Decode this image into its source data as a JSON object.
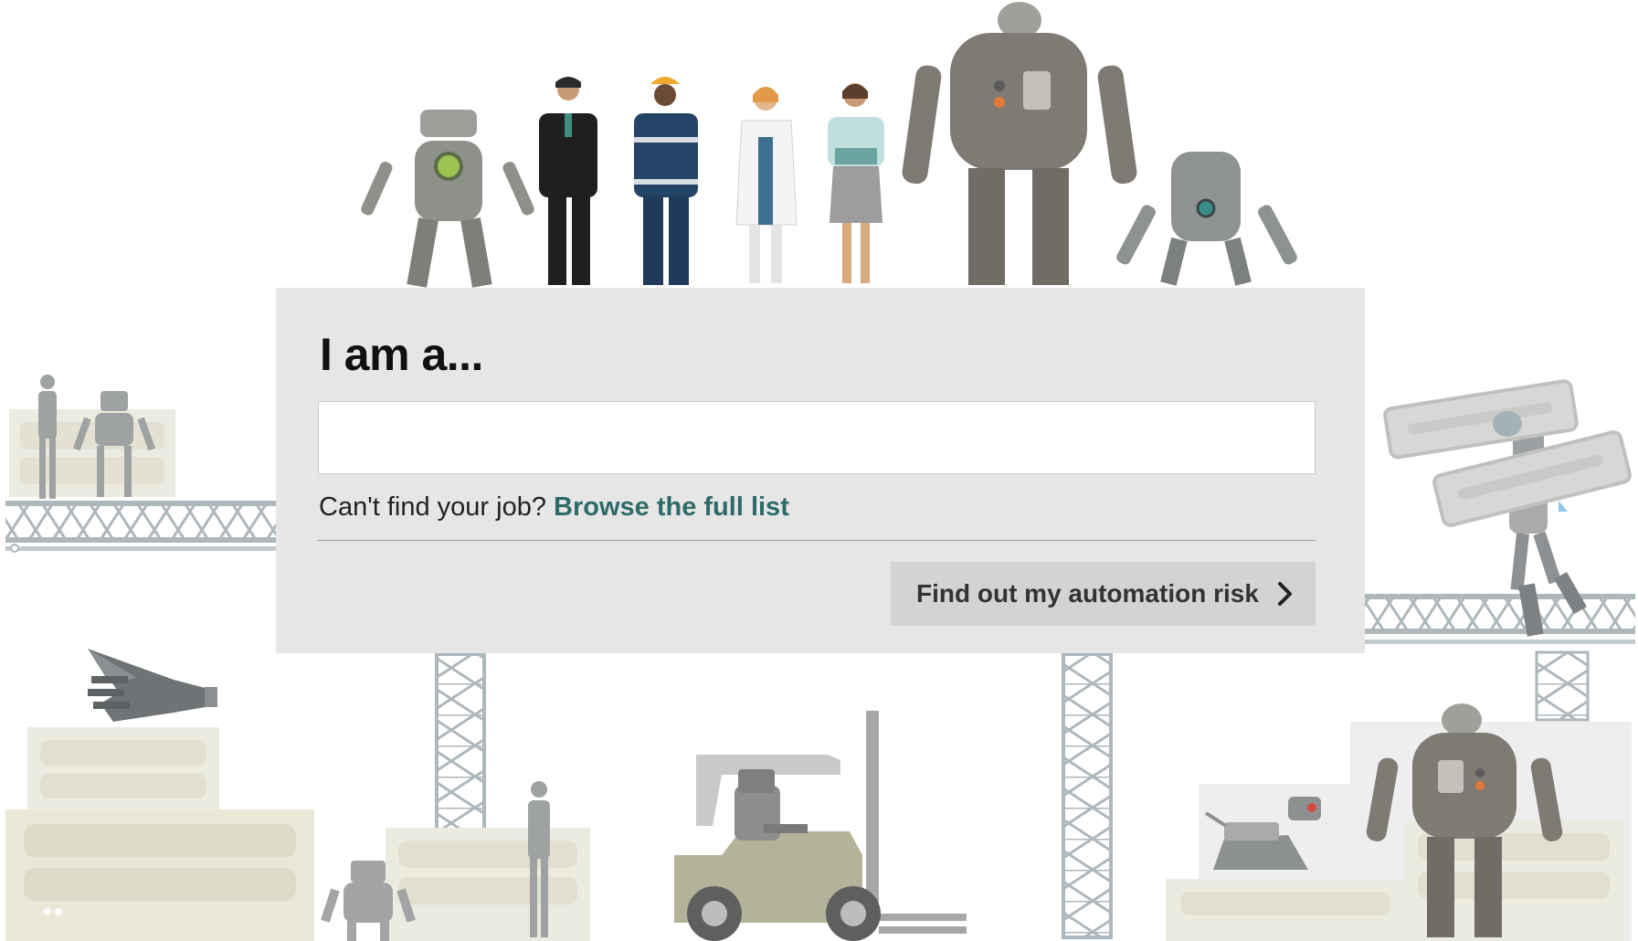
{
  "form": {
    "heading": "I am a...",
    "job_input": {
      "value": "",
      "placeholder": ""
    },
    "help_text": "Can't find your job?",
    "browse_link": "Browse the full list",
    "submit_label": "Find out my automation risk",
    "submit_icon": "chevron-right-icon"
  },
  "illustration": {
    "lineup": [
      "robot",
      "businessman",
      "construction-worker",
      "doctor",
      "office-worker",
      "large-robot",
      "small-robot"
    ],
    "background": [
      "scaffold-bridges",
      "crates",
      "drone",
      "forklift-robot",
      "robot-dog",
      "robot-carrying-panels",
      "person-silhouettes"
    ]
  },
  "colors": {
    "panel_bg": "#e6e6e6",
    "link": "#2e6b68",
    "button_bg": "#d3d3d3",
    "scaffold": "#b9c2c7",
    "crate": "#e9e6d6"
  }
}
